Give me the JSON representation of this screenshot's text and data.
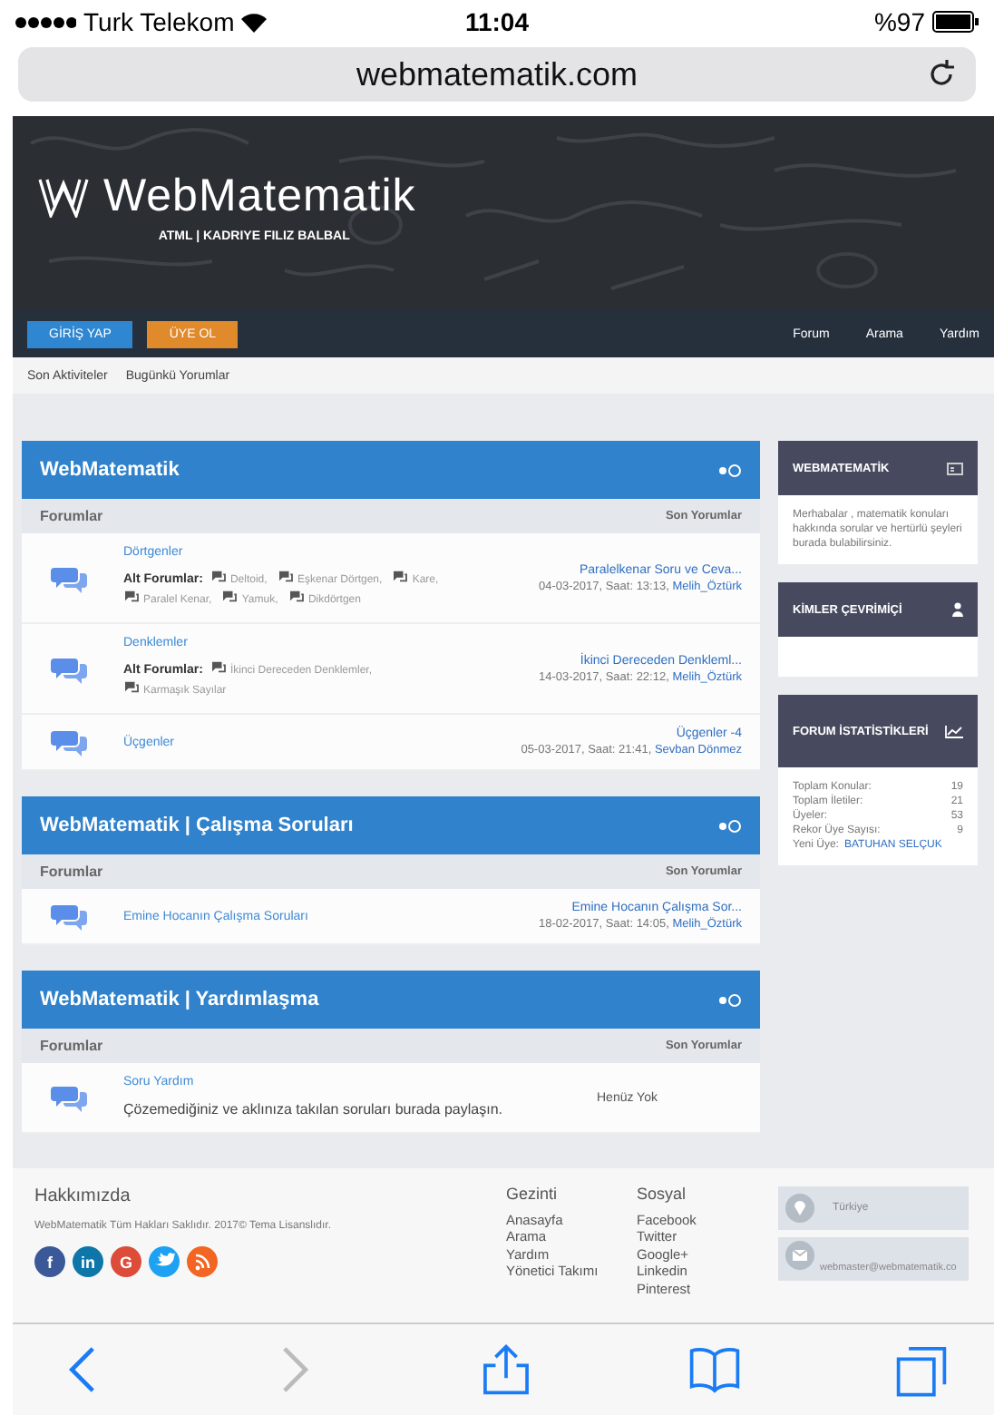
{
  "status_bar": {
    "carrier": "Turk Telekom",
    "time": "11:04",
    "battery": "%97"
  },
  "address_bar": {
    "url": "webmatematik.com"
  },
  "header": {
    "site_name": "WebMatematik",
    "subtitle": "ATML | KADRIYE FILIZ BALBAL"
  },
  "nav": {
    "buttons": [
      {
        "label": "GİRİŞ YAP",
        "color": "#2f86d1"
      },
      {
        "label": "ÜYE OL",
        "color": "#e08a2c"
      }
    ],
    "links": [
      "Forum",
      "Arama",
      "Yardım"
    ]
  },
  "subnav": [
    "Son Aktiviteler",
    "Bugünkü Yorumlar"
  ],
  "categories": [
    {
      "title": "WebMatematik",
      "col_forums": "Forumlar",
      "col_last": "Son Yorumlar",
      "forums": [
        {
          "title": "Dörtgenler",
          "subforums_label": "Alt Forumlar:",
          "subforums": [
            "Deltoid,",
            "Eşkenar Dörtgen,",
            "Kare,",
            "Paralel Kenar,",
            "Yamuk,",
            "Dikdörtgen"
          ],
          "last": {
            "title": "Paralelkenar Soru ve Ceva...",
            "date": "04-03-2017, Saat: 13:13,",
            "user": "Melih_Öztürk"
          }
        },
        {
          "title": "Denklemler",
          "subforums_label": "Alt Forumlar:",
          "subforums": [
            "İkinci Dereceden Denklemler,",
            "Karmaşık Sayılar"
          ],
          "last": {
            "title": "İkinci Dereceden Denkleml...",
            "date": "14-03-2017, Saat: 22:12,",
            "user": "Melih_Öztürk"
          }
        },
        {
          "title": "Üçgenler",
          "last": {
            "title": "Üçgenler -4",
            "date": "05-03-2017, Saat: 21:41,",
            "user": "Sevban Dönmez"
          }
        }
      ]
    },
    {
      "title": "WebMatematik | Çalışma Soruları",
      "col_forums": "Forumlar",
      "col_last": "Son Yorumlar",
      "forums": [
        {
          "title": "Emine Hocanın Çalışma Soruları",
          "last": {
            "title": "Emine Hocanın Çalışma Sor...",
            "date": "18-02-2017, Saat: 14:05,",
            "user": "Melih_Öztürk"
          }
        }
      ]
    },
    {
      "title": "WebMatematik | Yardımlaşma",
      "col_forums": "Forumlar",
      "col_last": "Son Yorumlar",
      "forums": [
        {
          "title": "Soru Yardım",
          "description": "Çözemediğiniz ve aklınıza takılan soruları burada paylaşın.",
          "no_post": "Henüz Yok"
        }
      ]
    }
  ],
  "sidebar": [
    {
      "kind": "text",
      "title": "WEBMATEMATİK",
      "text": "Merhabalar , matematik konuları hakkında sorular ve hertürlü şeyleri burada bulabilirsiniz."
    },
    {
      "kind": "online",
      "title": "KİMLER ÇEVRİMİÇİ"
    },
    {
      "kind": "stats",
      "title": "FORUM İSTATİSTİKLERİ",
      "rows": [
        {
          "label": "Toplam Konular:",
          "value": "19"
        },
        {
          "label": "Toplam İletiler:",
          "value": "21"
        },
        {
          "label": "Üyeler:",
          "value": "53"
        },
        {
          "label": "Rekor Üye Sayısı:",
          "value": "9"
        }
      ],
      "newest_label": "Yeni Üye:",
      "newest": "BATUHAN SELÇUK"
    }
  ],
  "footer": {
    "about_title": "Hakkımızda",
    "about_text": "WebMatematik Tüm Hakları Saklıdır. 2017© Tema Lisanslıdır.",
    "social": [
      {
        "kind": "text",
        "label": "f",
        "color": "#3b5998"
      },
      {
        "kind": "text",
        "label": "in",
        "color": "#0e76a8"
      },
      {
        "kind": "text",
        "label": "G",
        "color": "#dd4b39"
      },
      {
        "kind": "twitter",
        "color": "#1da1f2"
      },
      {
        "kind": "rss",
        "color": "#f26522"
      }
    ],
    "nav_title": "Gezinti",
    "nav_links": [
      "Anasayfa",
      "Arama",
      "Yardım",
      "Yönetici Takımı"
    ],
    "social_title": "Sosyal",
    "social_links": [
      "Facebook",
      "Twitter",
      "Google+",
      "Linkedin",
      "Pinterest"
    ],
    "contacts": [
      {
        "kind": "location",
        "text": "Türkiye"
      },
      {
        "kind": "mail",
        "text": "webmaster@webmatematik.co"
      }
    ]
  },
  "toolbar": [
    {
      "kind": "back",
      "disabled": false
    },
    {
      "kind": "forward",
      "disabled": true
    },
    {
      "kind": "share",
      "disabled": false
    },
    {
      "kind": "bookmarks",
      "disabled": false
    },
    {
      "kind": "tabs",
      "disabled": false
    }
  ]
}
